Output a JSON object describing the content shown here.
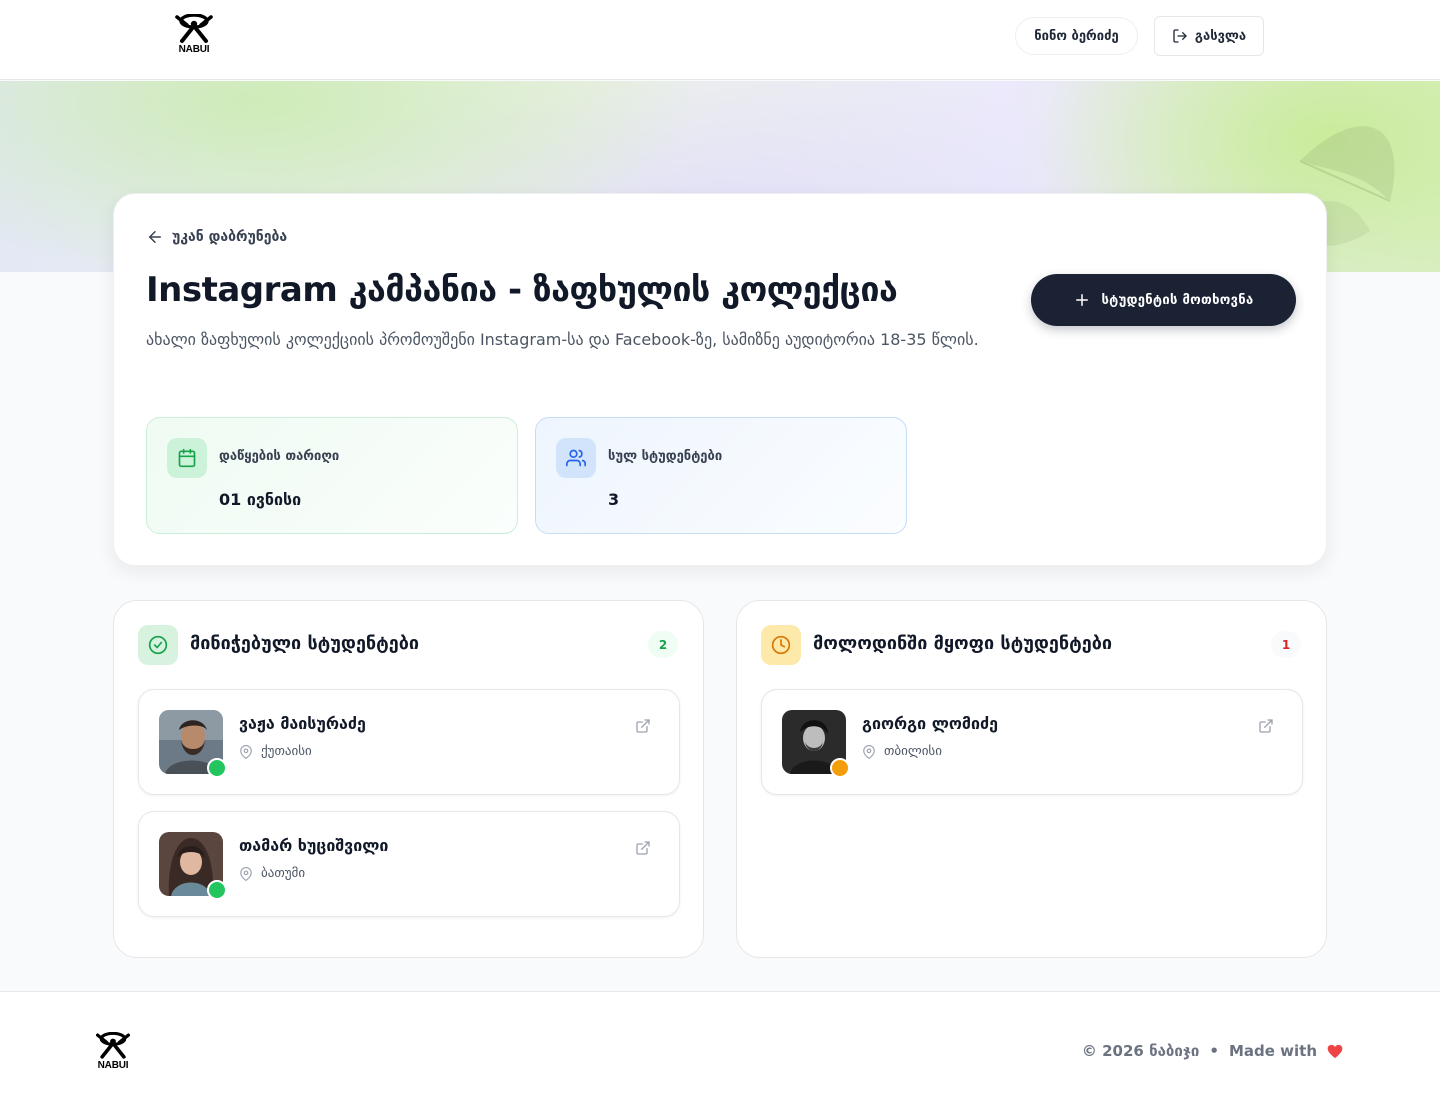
{
  "header": {
    "logo_text": "NABUI",
    "user_name": "ნინო ბერიძე",
    "logout_label": "გასვლა"
  },
  "campaign": {
    "back_label": "უკან დაბრუნება",
    "title": "Instagram კამპანია - ზაფხულის კოლექცია",
    "description": "ახალი ზაფხულის კოლექციის პრომოუშენი Instagram-სა და Facebook-ზე, სამიზნე აუდიტორია 18-35 წლის.",
    "request_button_label": "სტუდენტის მოთხოვნა",
    "stats": [
      {
        "label": "დაწყების თარიღი",
        "value": "01 ივნისი",
        "icon": "calendar-icon"
      },
      {
        "label": "სულ სტუდენტები",
        "value": "3",
        "icon": "users-icon"
      }
    ]
  },
  "panels": {
    "selected": {
      "title": "მინიჭებული სტუდენტები",
      "count": "2",
      "icon": "check-circle-icon",
      "students": [
        {
          "name": "ვაჟა მაისურაძე",
          "location": "ქუთაისი",
          "status": "active"
        },
        {
          "name": "თამარ ხუციშვილი",
          "location": "ბათუმი",
          "status": "active"
        }
      ]
    },
    "pending": {
      "title": "მოლოდინში მყოფი სტუდენტები",
      "count": "1",
      "icon": "clock-icon",
      "students": [
        {
          "name": "გიორგი ლომიძე",
          "location": "თბილისი",
          "status": "pending"
        }
      ]
    }
  },
  "footer": {
    "logo_text": "NABUI",
    "copyright": "© 2026 ნაბიჯი",
    "separator": "•",
    "made_with": "Made with"
  },
  "colors": {
    "primary_dark": "#1a2233",
    "active": "#22c55e",
    "pending": "#f59e0b",
    "heart": "#ef4444"
  }
}
